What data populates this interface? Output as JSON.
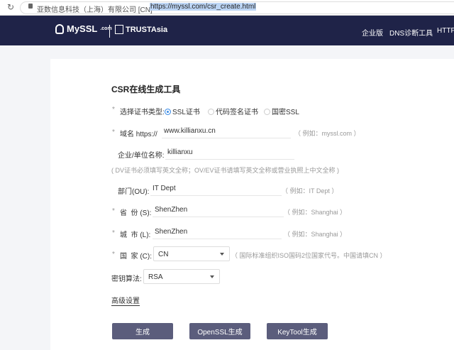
{
  "browser": {
    "org": "亚数信息科技（上海）有限公司 [CN]",
    "url": "https://myssl.com/csr_create.html"
  },
  "header": {
    "logo": "MySSL",
    "logo_suffix": ".com",
    "partner": "TRUSTAsia",
    "nav": [
      "企业版",
      "DNS诊断工具",
      "HTTP"
    ]
  },
  "form": {
    "title": "CSR在线生成工具",
    "cert_type_label": "选择证书类型:",
    "cert_types": [
      "SSL证书",
      "代码签名证书",
      "国密SSL"
    ],
    "domain_label": "域名 https://",
    "domain_value": "www.killianxu.cn",
    "domain_hint": "（ 例如：myssl.com ）",
    "org_label": "企业/单位名称:",
    "org_value": "killianxu",
    "org_note": "( DV证书必须填写英文全称；OV/EV证书请填写英文全称或营业执照上中文全称 )",
    "ou_label": "部门(OU):",
    "ou_value": "IT Dept",
    "ou_hint": "（ 例如：IT Dept ）",
    "state_label": "省  份 (S):",
    "state_value": "ShenZhen",
    "state_hint": "（ 例如：Shanghai ）",
    "city_label": "城  市 (L):",
    "city_value": "ShenZhen",
    "city_hint": "（ 例如：Shanghai ）",
    "country_label": "国  家 (C):",
    "country_value": "CN",
    "country_hint": "（ 国际标准组织ISO国码2位国家代号。中国请填CN ）",
    "key_label": "密钥算法:",
    "key_value": "RSA",
    "advanced": "高级设置",
    "buttons": [
      "生成",
      "OpenSSL生成",
      "KeyTool生成"
    ]
  },
  "colors": {
    "header": "#1f2348",
    "button": "#5b5d7c",
    "radio": "#3d8de6"
  }
}
